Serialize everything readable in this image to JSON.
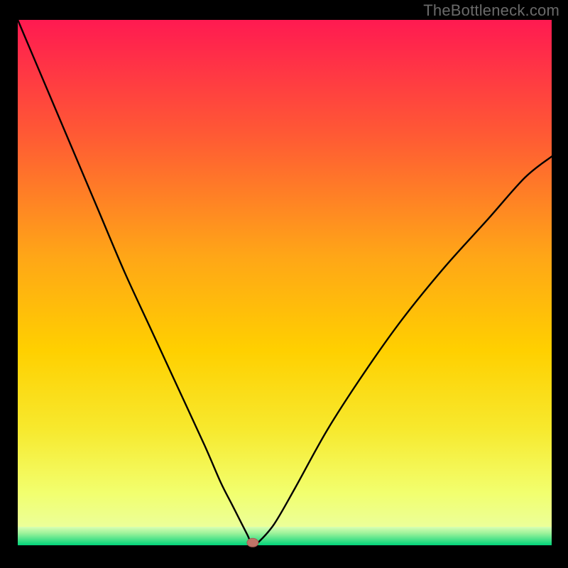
{
  "watermark": "TheBottleneck.com",
  "chart_data": {
    "type": "line",
    "title": "",
    "xlabel": "",
    "ylabel": "",
    "xlim": [
      0,
      100
    ],
    "ylim": [
      0,
      100
    ],
    "legend": false,
    "x": [
      0,
      5,
      10,
      15,
      20,
      25,
      30,
      35,
      38,
      40,
      42,
      43,
      44,
      45,
      48,
      52,
      58,
      65,
      72,
      80,
      88,
      95,
      100
    ],
    "values": [
      100,
      88,
      76,
      64,
      52,
      41,
      30,
      19,
      12,
      8,
      4,
      2,
      0,
      0.5,
      4,
      11,
      22,
      33,
      43,
      53,
      62,
      70,
      74
    ],
    "minimum_x": 43.5,
    "marker": {
      "x": 44,
      "y": 0.5
    },
    "background_gradient": [
      "#ff1a51",
      "#ff6a29",
      "#ffd000",
      "#f4ec2f",
      "#e8ff84",
      "#00d977"
    ],
    "bottom_band_color": "#00d977"
  }
}
